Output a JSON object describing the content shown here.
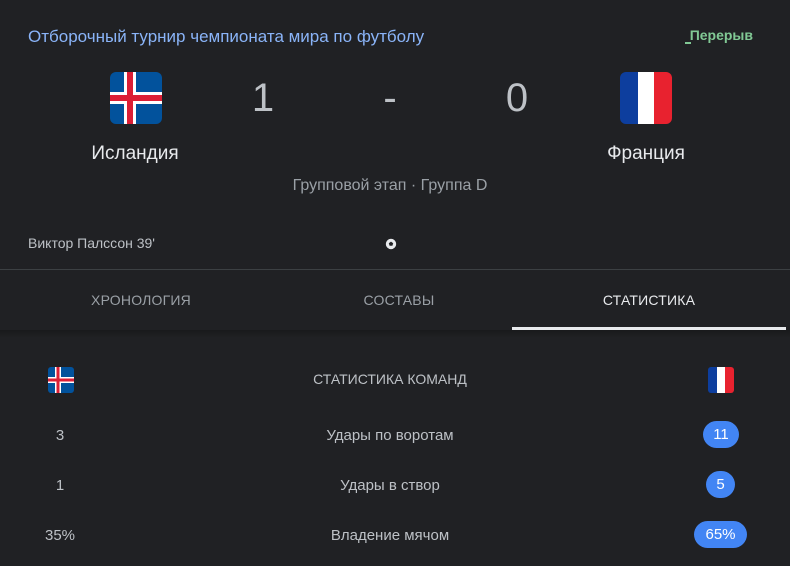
{
  "header": {
    "tournament": "Отборочный турнир чемпионата мира по футболу",
    "status": "Перерыв"
  },
  "match": {
    "home": {
      "name": "Исландия",
      "score": "1",
      "flag_icon": "iceland-flag-icon"
    },
    "separator": "-",
    "away": {
      "name": "Франция",
      "score": "0",
      "flag_icon": "france-flag-icon"
    },
    "stage": "Групповой этап · Группа D",
    "goal_event": "Виктор Палссон 39'"
  },
  "tabs": [
    {
      "label": "ХРОНОЛОГИЯ",
      "active": false
    },
    {
      "label": "СОСТАВЫ",
      "active": false
    },
    {
      "label": "СТАТИСТИКА",
      "active": true
    }
  ],
  "stats": {
    "header": "СТАТИСТИКА КОМАНД",
    "rows": [
      {
        "home": "3",
        "label": "Удары по воротам",
        "away": "11"
      },
      {
        "home": "1",
        "label": "Удары в створ",
        "away": "5"
      },
      {
        "home": "35%",
        "label": "Владение мячом",
        "away": "65%"
      }
    ]
  },
  "colors": {
    "background": "#202124",
    "link": "#8ab4f8",
    "status": "#81c995",
    "pill": "#4285f4"
  }
}
